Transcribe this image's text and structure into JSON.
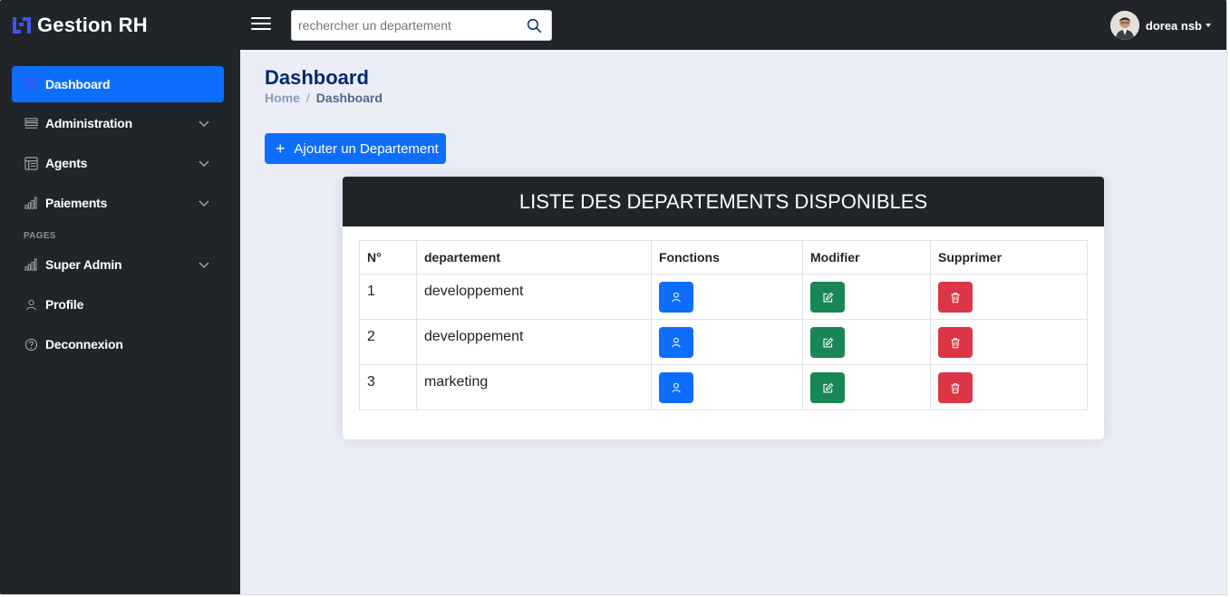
{
  "header": {
    "brand": "Gestion RH",
    "search_placeholder": "rechercher un departement",
    "user_name": "dorea nsb"
  },
  "sidebar": {
    "items": [
      {
        "label": "Dashboard",
        "icon": "grid-icon",
        "active": true
      },
      {
        "label": "Administration",
        "icon": "list-icon",
        "expandable": true
      },
      {
        "label": "Agents",
        "icon": "table-icon",
        "expandable": true
      },
      {
        "label": "Paiements",
        "icon": "bar-chart-icon",
        "expandable": true
      }
    ],
    "section": "PAGES",
    "pages": [
      {
        "label": "Super Admin",
        "icon": "bar-chart-icon",
        "expandable": true
      },
      {
        "label": "Profile",
        "icon": "person-icon"
      },
      {
        "label": "Deconnexion",
        "icon": "question-circle-icon"
      }
    ]
  },
  "main": {
    "title": "Dashboard",
    "breadcrumb": {
      "home": "Home",
      "separator": "/",
      "current": "Dashboard"
    },
    "add_button": {
      "icon": "+",
      "label": "Ajouter un Departement"
    }
  },
  "card": {
    "title": "LISTE DES DEPARTEMENTS DISPONIBLES",
    "columns": [
      "N°",
      "departement",
      "Fonctions",
      "Modifier",
      "Supprimer"
    ],
    "rows": [
      {
        "num": "1",
        "departement": "developpement"
      },
      {
        "num": "2",
        "departement": "developpement"
      },
      {
        "num": "3",
        "departement": "marketing"
      }
    ]
  },
  "colors": {
    "dark": "#212529",
    "primary": "#0d6efd",
    "success": "#198754",
    "danger": "#dc3545",
    "background": "#eceef7",
    "title": "#012970"
  }
}
